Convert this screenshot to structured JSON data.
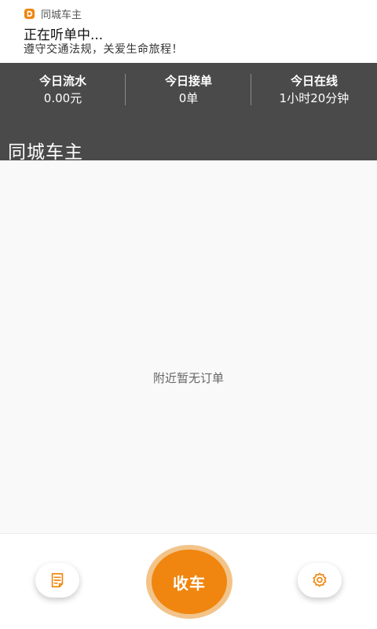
{
  "notification": {
    "app_name": "同城车主",
    "title": "正在听单中...",
    "body": "遵守交通法规，关爱生命旅程！"
  },
  "stats": [
    {
      "label": "今日流水",
      "value": "0.00元"
    },
    {
      "label": "今日接单",
      "value": "0单"
    },
    {
      "label": "今日在线",
      "value": "1小时20分钟"
    }
  ],
  "app_title": "同城车主",
  "main": {
    "empty_text": "附近暂无订单"
  },
  "bottom_bar": {
    "orders_icon": "document-icon",
    "main_button_label": "收车",
    "settings_icon": "gear-icon"
  },
  "colors": {
    "accent": "#f0860f",
    "accent_ring": "#f2c48a",
    "header_bg": "#4a4a4a"
  }
}
